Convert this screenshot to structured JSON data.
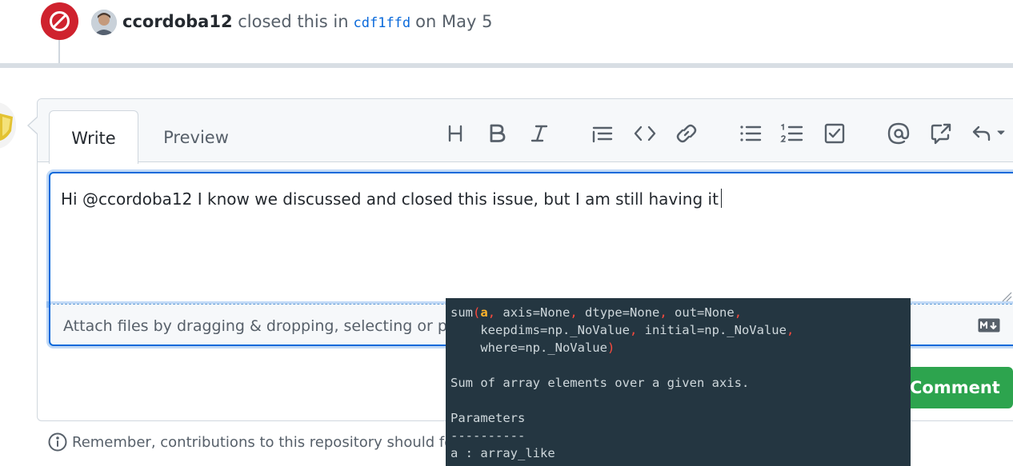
{
  "closed_event": {
    "user": "ccordoba12",
    "action": "closed this in",
    "commit": "cdf1ffd",
    "date": "on May 5",
    "badge_color": "#cf222e"
  },
  "editor": {
    "tabs": [
      "Write",
      "Preview"
    ],
    "toolbar_icons": [
      "heading-icon",
      "bold-icon",
      "italic-icon",
      "quote-icon",
      "code-icon",
      "link-icon",
      "bulleted-list-icon",
      "numbered-list-icon",
      "task-list-icon",
      "mention-icon",
      "cross-reference-icon",
      "reply-icon"
    ],
    "text": "Hi @ccordoba12  I know we discussed and closed this issue, but I am still having it",
    "attach_text": "Attach files by dragging & dropping, selecting or p",
    "markdown_icon": "markdown-icon"
  },
  "comment_button": "Comment",
  "remember_text": "Remember, contributions to this repository should fo",
  "tooltip": {
    "func": "sum",
    "open": "(",
    "arg_a": "a",
    "c1": ",",
    "p1": " axis=None",
    "c2": ",",
    "p2": " dtype=None",
    "c3": ",",
    "p3": " out=None",
    "c4": ",",
    "p4": "    keepdims=np._NoValue",
    "c5": ",",
    "p5": " initial=np._NoValue",
    "c6": ",",
    "p6": "    where=np._NoValue",
    "close": ")",
    "description": "Sum of array elements over a given axis.",
    "section": "Parameters",
    "rule": "----------",
    "param": "a : array_like",
    "colors": {
      "background": "#243641",
      "paren": "#ff4a3d",
      "active_arg": "#ffb52b"
    }
  },
  "colors": {
    "accent": "#0969da",
    "comment_button": "#2da44e"
  }
}
